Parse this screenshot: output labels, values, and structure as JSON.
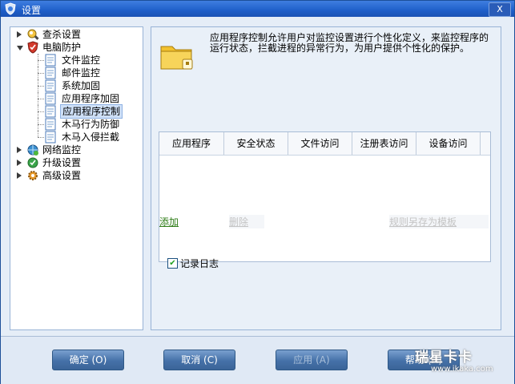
{
  "window": {
    "title": "设置",
    "close_label": "X"
  },
  "tree": {
    "items": [
      {
        "label": "查杀设置",
        "icon": "scan-icon",
        "expanded": false
      },
      {
        "label": "电脑防护",
        "icon": "shield-icon",
        "expanded": true
      },
      {
        "label": "网络监控",
        "icon": "network-icon",
        "expanded": false
      },
      {
        "label": "升级设置",
        "icon": "update-icon",
        "expanded": false
      },
      {
        "label": "高级设置",
        "icon": "gear-icon",
        "expanded": false
      }
    ],
    "children": [
      {
        "label": "文件监控",
        "icon": "page-icon"
      },
      {
        "label": "邮件监控",
        "icon": "page-icon"
      },
      {
        "label": "系统加固",
        "icon": "page-icon"
      },
      {
        "label": "应用程序加固",
        "icon": "page-icon"
      },
      {
        "label": "应用程序控制",
        "icon": "page-icon",
        "selected": true
      },
      {
        "label": "木马行为防御",
        "icon": "page-icon"
      },
      {
        "label": "木马入侵拦截",
        "icon": "page-icon"
      }
    ]
  },
  "content": {
    "description": "应用程序控制允许用户对监控设置进行个性化定义，来监控程序的运行状态，拦截进程的异常行为，为用户提供个性化的保护。",
    "columns": [
      "应用程序",
      "安全状态",
      "文件访问",
      "注册表访问",
      "设备访问"
    ],
    "links": {
      "add": "添加",
      "delete": "删除",
      "save_template": "规则另存为模板"
    },
    "log": {
      "label": "记录日志",
      "checked": true
    }
  },
  "buttons": {
    "ok": "确定 (O)",
    "cancel": "取消 (C)",
    "apply": "应用 (A)",
    "help": "帮助 (H)"
  },
  "watermark": {
    "text": "瑞星卡卡",
    "url": "www.ikaka.com"
  },
  "colors": {
    "title_bar": "#1f5fc9",
    "panel_bg": "#e9f0f8",
    "link_green": "#2f7d18",
    "selected_bg": "#cfe0f7"
  }
}
